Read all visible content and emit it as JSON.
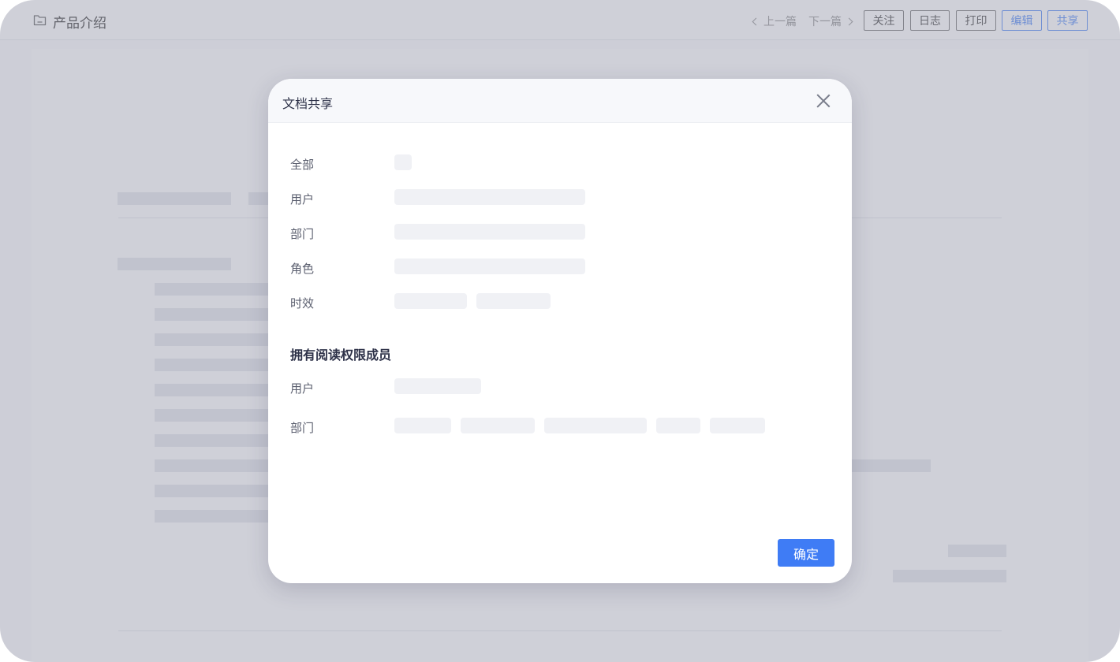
{
  "header": {
    "title": "产品介绍",
    "prev_label": "上一篇",
    "next_label": "下一篇",
    "buttons": {
      "follow": "关注",
      "log": "日志",
      "print": "打印",
      "edit": "编辑",
      "share": "共享"
    }
  },
  "modal": {
    "title": "文档共享",
    "fields": {
      "all": "全部",
      "user": "用户",
      "dept": "部门",
      "role": "角色",
      "validity": "时效"
    },
    "section_title": "拥有阅读权限成员",
    "members": {
      "user": "用户",
      "dept": "部门"
    },
    "confirm": "确定"
  },
  "colors": {
    "accent": "#3f7cf5",
    "overlay": "rgba(160,162,178,0.5)",
    "placeholder": "#f0f1f5"
  },
  "icons": {
    "folder": "folder-icon",
    "close": "close-icon",
    "prev": "chevron-left-icon",
    "next": "chevron-right-icon"
  }
}
